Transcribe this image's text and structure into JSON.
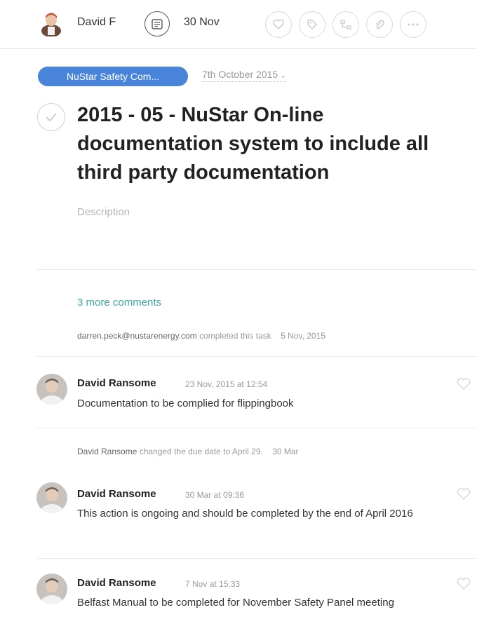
{
  "toolbar": {
    "assignee": "David F",
    "due_date": "30 Nov",
    "actions": [
      "heart-icon",
      "tag-icon",
      "subtask-icon",
      "attachment-icon",
      "more-icon"
    ]
  },
  "task": {
    "project": "NuStar Safety Com...",
    "created_date": "7th October 2015",
    "title": "2015 - 05 - NuStar On-line documentation system to include all third party documentation",
    "description_placeholder": "Description"
  },
  "activity": {
    "more_comments": "3 more comments",
    "story1": {
      "actor": "darren.peck@nustarenergy.com",
      "text": "completed this task",
      "when": "5 Nov, 2015"
    },
    "story2": {
      "actor": "David Ransome",
      "text": "changed the due date to April 29.",
      "when": "30 Mar"
    },
    "comments": [
      {
        "author": "David Ransome",
        "time": "23 Nov, 2015 at 12:54",
        "text": "Documentation to be complied for flippingbook"
      },
      {
        "author": "David Ransome",
        "time": "30 Mar at 09:36",
        "text": "This action is ongoing and should be completed by the end of April 2016"
      },
      {
        "author": "David Ransome",
        "time": "7 Nov at 15:33",
        "text": "Belfast Manual to be completed for November Safety Panel meeting"
      }
    ]
  },
  "colors": {
    "project_tag": "#4a84da",
    "link": "#3ea6a6"
  }
}
